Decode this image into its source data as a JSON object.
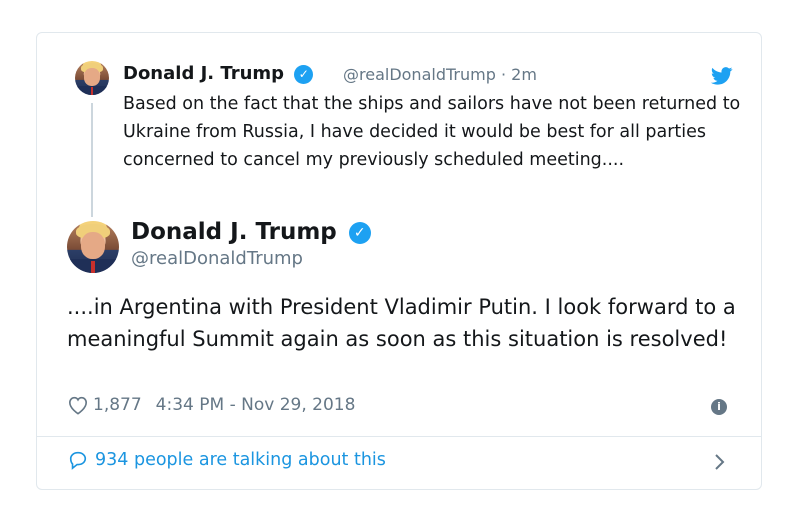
{
  "quoted_tweet": {
    "author_name": "Donald J. Trump",
    "handle": "@realDonaldTrump",
    "separator": "·",
    "time_ago": "2m",
    "text": "Based on the fact that the ships and sailors have not been returned to Ukraine from Russia, I have decided it would be best for all parties concerned to cancel my previously scheduled meeting....",
    "icon": "twitter-bird-icon"
  },
  "main_tweet": {
    "author_name": "Donald J. Trump",
    "handle": "@realDonaldTrump",
    "text": "....in Argentina with President Vladimir Putin. I look forward to a meaningful Summit again as soon as this situation is resolved!",
    "like_count": "1,877",
    "timestamp": "4:34 PM - Nov 29, 2018"
  },
  "footer": {
    "talking_text": "934 people are talking about this"
  },
  "colors": {
    "accent": "#1da1f2",
    "link": "#1b95e0",
    "muted": "#657786"
  }
}
